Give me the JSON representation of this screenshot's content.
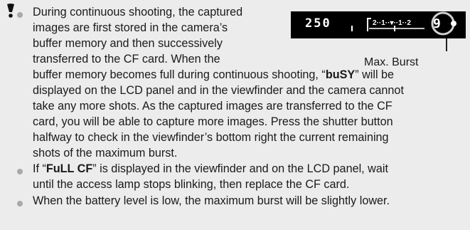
{
  "p1": {
    "l1": "During continuous shooting, the captured",
    "l2": "images are first stored in the camera’s",
    "l3": "buffer memory and then successively",
    "l4": "transferred to the CF card. When the",
    "l5a": "buffer memory becomes full during continuous shooting, “",
    "l5b": "buSY",
    "l5c": "” will be",
    "l6": "displayed on the LCD panel and in the viewfinder and the camera cannot",
    "l7": "take any more shots. As the captured images are transferred to the CF",
    "l8": "card, you will be able to capture more images. Press the shutter button",
    "l9": "halfway to check in the viewfinder’s bottom right the current remaining",
    "l10": "shots of the maximum burst."
  },
  "p2": {
    "l1a": "If “",
    "l1b": "FuLL CF",
    "l1c": "” is displayed in the viewfinder and on the LCD panel, wait",
    "l2": "until the access lamp stops blinking, then replace the CF card."
  },
  "p3": {
    "l1": "When the battery level is low, the maximum burst will be slightly lower."
  },
  "lcd": {
    "speed": "250",
    "scale": "2··1··▾··1··2",
    "burst": "9",
    "caption": "Max. Burst"
  }
}
